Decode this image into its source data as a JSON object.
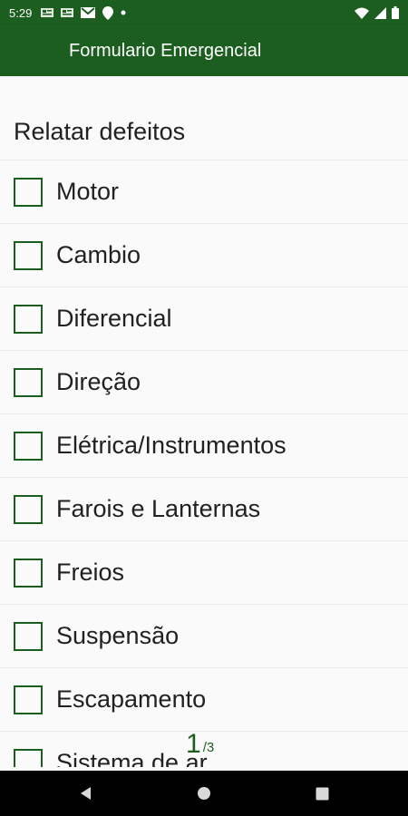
{
  "status_bar": {
    "time": "5:29",
    "icons_left": [
      "news-icon",
      "news-icon",
      "gmail-icon",
      "location-pin-icon",
      "dot-icon"
    ],
    "icons_right": [
      "wifi-icon",
      "signal-icon",
      "battery-icon"
    ]
  },
  "app_bar": {
    "title": "Formulario Emergencial"
  },
  "form": {
    "section_title": "Relatar defeitos",
    "items": [
      {
        "label": "Motor",
        "checked": false
      },
      {
        "label": "Cambio",
        "checked": false
      },
      {
        "label": "Diferencial",
        "checked": false
      },
      {
        "label": "Direção",
        "checked": false
      },
      {
        "label": "Elétrica/Instrumentos",
        "checked": false
      },
      {
        "label": "Farois e Lanternas",
        "checked": false
      },
      {
        "label": "Freios",
        "checked": false
      },
      {
        "label": "Suspensão",
        "checked": false
      },
      {
        "label": "Escapamento",
        "checked": false
      },
      {
        "label": "Sistema de ar",
        "checked": false
      }
    ]
  },
  "page_indicator": {
    "current": "1",
    "separator": "/3"
  },
  "nav_bar": {
    "buttons": [
      "back-icon",
      "home-icon",
      "recents-icon"
    ]
  },
  "colors": {
    "primary": "#1b5e20",
    "background": "#fafafa",
    "text": "#212121"
  }
}
